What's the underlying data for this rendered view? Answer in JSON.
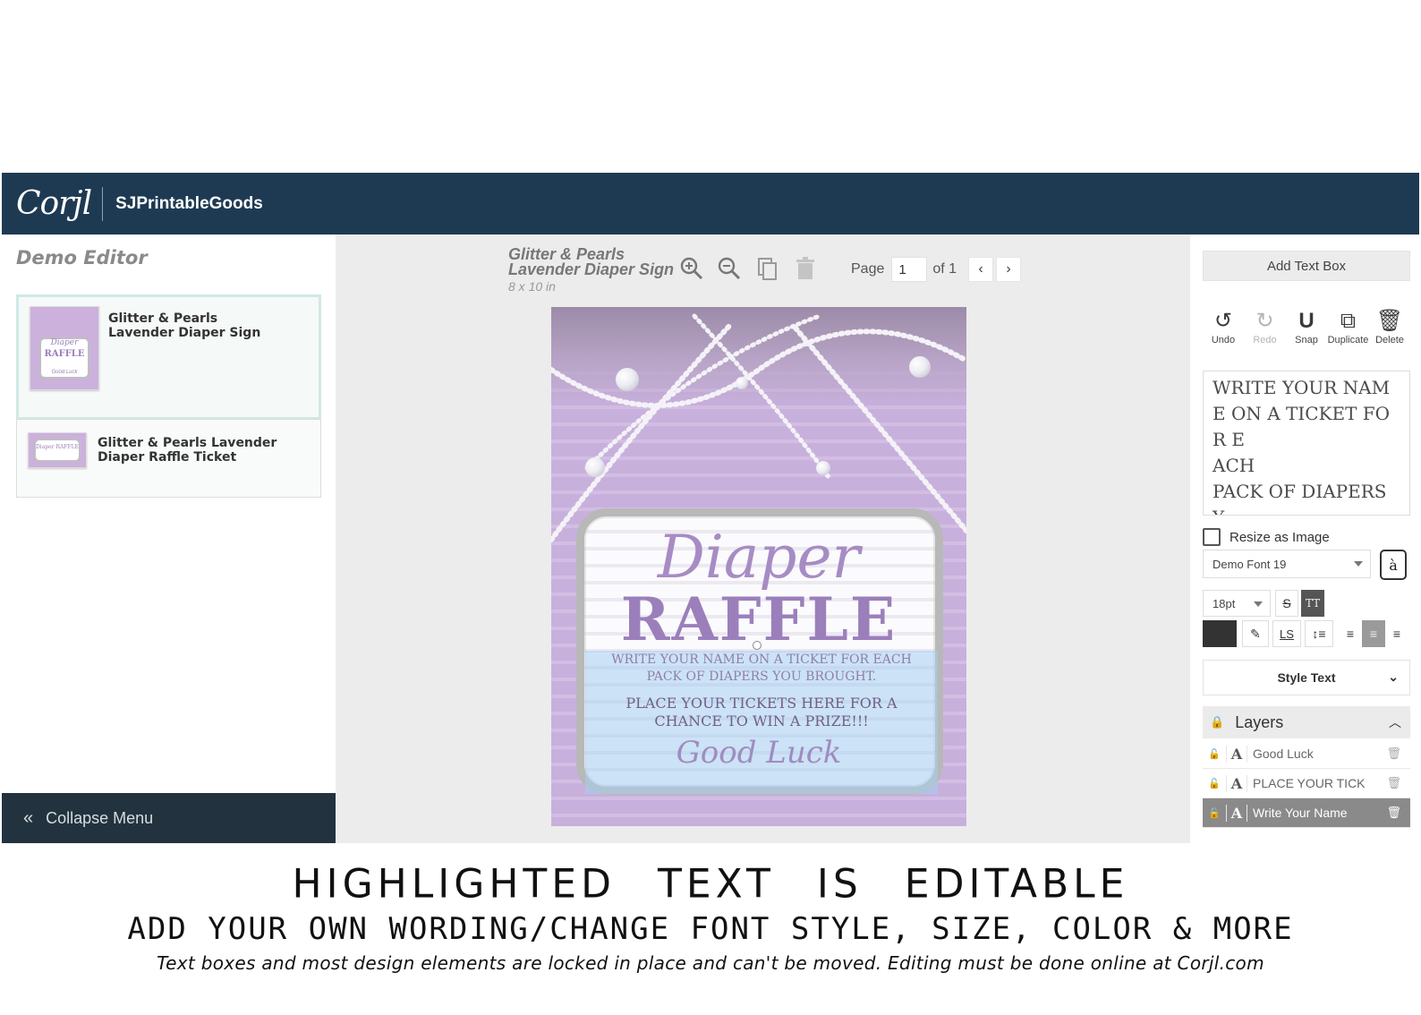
{
  "header": {
    "logo": "Corjl",
    "shop_name": "SJPrintableGoods"
  },
  "left_panel": {
    "title": "Demo Editor",
    "projects": [
      {
        "name": "Glitter & Pearls Lavender Diaper Sign",
        "thumb_line1": "Diaper",
        "thumb_line2": "RAFFLE",
        "thumb_line3": "Good Luck"
      },
      {
        "name": "Glitter & Pearls Lavender Diaper Raffle Ticket",
        "thumb_line1": "Diaper RAFFLE"
      }
    ],
    "collapse_label": "Collapse Menu"
  },
  "toolbar": {
    "doc_title_line1": "Glitter & Pearls",
    "doc_title_line2": "Lavender Diaper Sign",
    "doc_size": "8 x 10 in",
    "icons": [
      "zoom-in-icon",
      "zoom-out-icon",
      "copy-icon",
      "trash-icon"
    ],
    "page_label": "Page",
    "page_value": "1",
    "page_of": "of 1"
  },
  "canvas": {
    "diaper": "Diaper",
    "raffle": "RAFFLE",
    "write_line1": "WRITE YOUR NAME ON A TICKET FOR EACH",
    "write_line2": "PACK OF DIAPERS YOU BROUGHT.",
    "place_line1": "PLACE YOUR TICKETS HERE FOR A",
    "place_line2": "CHANCE TO WIN A PRIZE!!!",
    "good_luck": "Good Luck",
    "colors": {
      "background": "#c8b0dd",
      "title": "#9b7fbb",
      "selection": "#a6cef0"
    }
  },
  "right_panel": {
    "add_text_box": "Add Text Box",
    "actions": [
      {
        "label": "Undo",
        "icon": "undo-icon",
        "enabled": true
      },
      {
        "label": "Redo",
        "icon": "redo-icon",
        "enabled": false
      },
      {
        "label": "Snap",
        "icon": "magnet-icon",
        "enabled": true
      },
      {
        "label": "Duplicate",
        "icon": "duplicate-icon",
        "enabled": true
      },
      {
        "label": "Delete",
        "icon": "trash-icon",
        "enabled": true
      }
    ],
    "text_value": "WRITE YOUR NAME ON A TICKET FOR E\nACH\nPACK OF DIAPERS Y\nOU BROUGHT.",
    "resize_as_image": "Resize as Image",
    "font_name": "Demo Font 19",
    "font_button": "à",
    "font_size": "18pt",
    "strike_label": "S",
    "caps_label": "TT",
    "letter_spacing_label": "LS",
    "text_color": "#333333",
    "style_text": "Style Text",
    "layers_title": "Layers",
    "layers": [
      {
        "name": "Good Luck",
        "selected": false
      },
      {
        "name": "PLACE YOUR TICK",
        "selected": false
      },
      {
        "name": "Write Your Name",
        "selected": true
      }
    ]
  },
  "captions": {
    "line1": "HIGHLIGHTED TEXT IS EDITABLE",
    "line2": "ADD YOUR OWN WORDING/CHANGE FONT STYLE, SIZE, COLOR & MORE",
    "line3": "Text boxes and most design elements are locked in place and can't be moved. Editing must be done online at Corjl.com"
  }
}
